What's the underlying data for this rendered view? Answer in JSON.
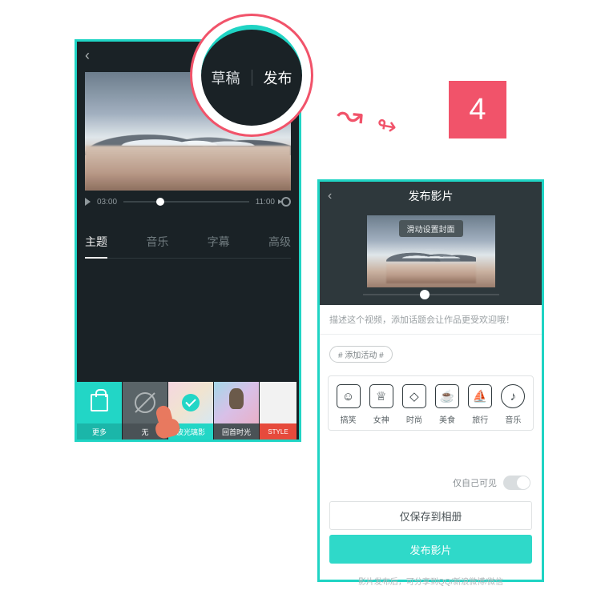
{
  "callout": {
    "draft": "草稿",
    "publish": "发布"
  },
  "step": {
    "number": "4"
  },
  "editor": {
    "scrub": {
      "current": "03:00",
      "total": "11:00"
    },
    "tabs": [
      "主题",
      "音乐",
      "字幕",
      "高级"
    ],
    "active_tab_index": 0,
    "themes": {
      "more": "更多",
      "none": "无",
      "selected": "波光璃影",
      "t4": "回首时光",
      "t5": "STYLE"
    }
  },
  "publish": {
    "title": "发布影片",
    "cover_hint": "滑动设置封面",
    "desc_placeholder": "描述这个视频，添加话题会让作品更受欢迎哦！",
    "topic_chip": "# 添加活动 #",
    "categories": [
      {
        "icon": "laugh-icon",
        "glyph": "☺",
        "label": "搞笑"
      },
      {
        "icon": "goddess-icon",
        "glyph": "♕",
        "label": "女神"
      },
      {
        "icon": "fashion-icon",
        "glyph": "◇",
        "label": "时尚"
      },
      {
        "icon": "food-icon",
        "glyph": "☕",
        "label": "美食"
      },
      {
        "icon": "travel-icon",
        "glyph": "⛵",
        "label": "旅行"
      },
      {
        "icon": "music-icon",
        "glyph": "♪",
        "label": "音乐",
        "round": true
      }
    ],
    "private_label": "仅自己可见",
    "save_button": "仅保存到相册",
    "publish_button": "发布影片",
    "footer_hint": "影片发布后，可分享到QQ/新浪微博/微信"
  }
}
